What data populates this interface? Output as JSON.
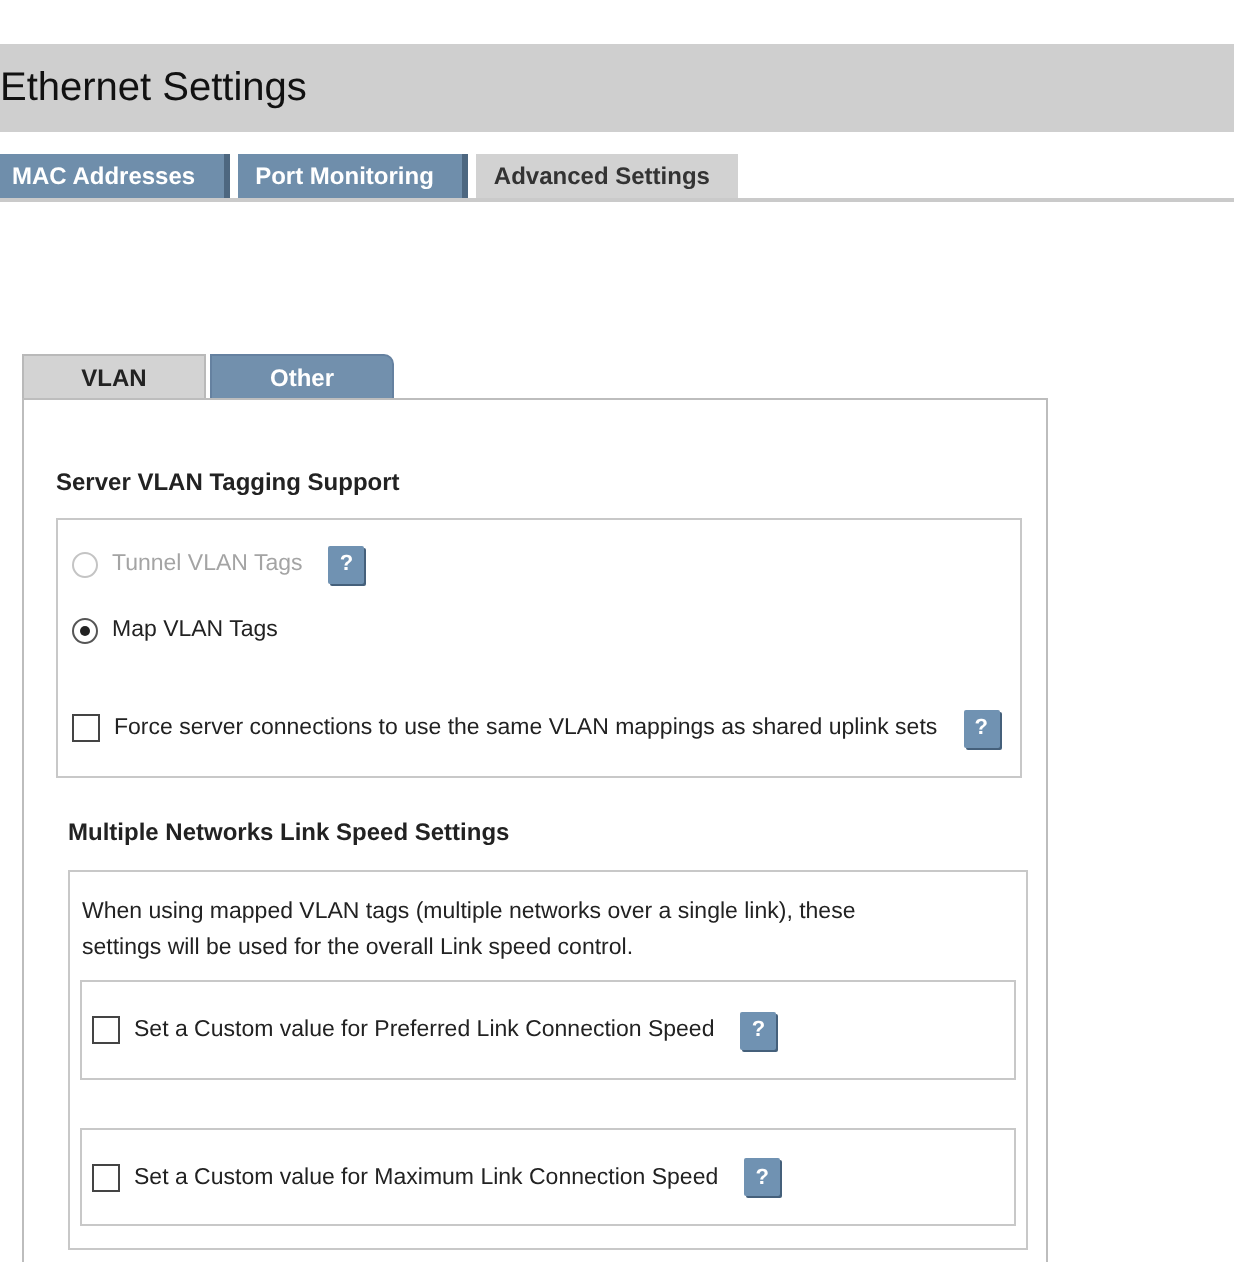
{
  "page_title": "Ethernet Settings",
  "tabs": [
    {
      "label": "MAC Addresses",
      "selected": false
    },
    {
      "label": "Port Monitoring",
      "selected": false
    },
    {
      "label": "Advanced Settings",
      "selected": true
    }
  ],
  "subtabs": [
    {
      "label": "VLAN",
      "selected": true
    },
    {
      "label": "Other",
      "selected": false
    }
  ],
  "vlan_tagging": {
    "title": "Server VLAN Tagging Support",
    "options": [
      {
        "label": "Tunnel VLAN Tags",
        "selected": false,
        "disabled": true,
        "help": "?"
      },
      {
        "label": "Map VLAN Tags",
        "selected": true,
        "disabled": false
      }
    ],
    "force_mapping": {
      "label": "Force server connections to use the same VLAN mappings as shared uplink sets",
      "checked": false,
      "help": "?"
    }
  },
  "link_speed": {
    "title": "Multiple Networks Link Speed Settings",
    "description": "When using mapped VLAN tags (multiple networks over a single link), these settings will be used for the overall Link speed control.",
    "options": [
      {
        "label": "Set a Custom value for Preferred Link Connection Speed",
        "checked": false,
        "help": "?"
      },
      {
        "label": "Set a Custom value for Maximum Link Connection Speed",
        "checked": false,
        "help": "?"
      }
    ]
  }
}
